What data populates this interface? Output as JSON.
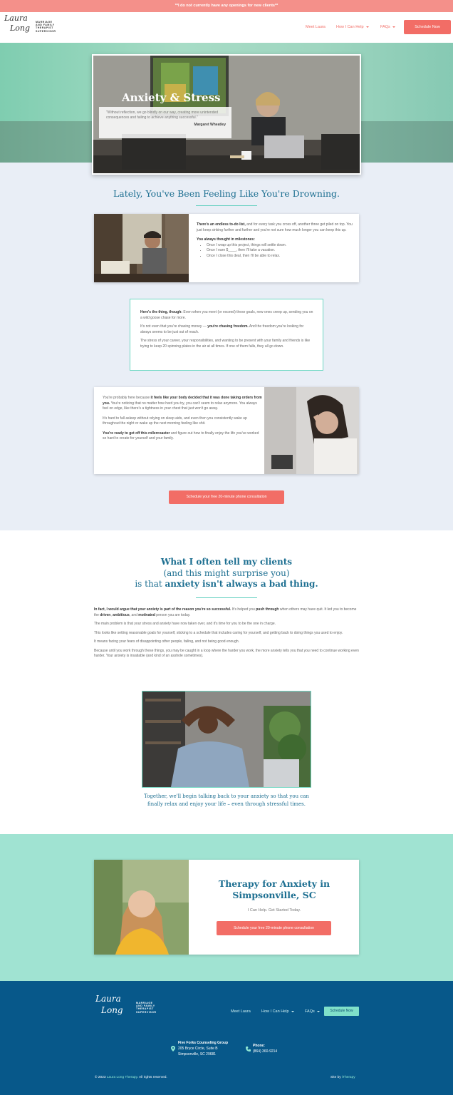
{
  "banner": {
    "text": "**I do not currently have any openings for new clients**"
  },
  "header": {
    "logo_line1": "Laura",
    "logo_line2": "Long",
    "logo_sub1": "MARRIAGE",
    "logo_sub2": "AND FAMILY",
    "logo_sub3": "THERAPIST",
    "logo_sub4": "SUPERVISOR",
    "nav": [
      "Meet Laura",
      "How I Can Help",
      "FAQs"
    ],
    "schedule_label": "Schedule Now"
  },
  "hero": {
    "title": "Anxiety & Stress",
    "quote": "\"Without reflection, we go blindly on our way, creating more unintended consequences and failing to achieve anything successful.\"",
    "quote_author": "Margaret Wheatley"
  },
  "drowning": {
    "heading": "Lately, You've Been Feeling Like You're Drowning.",
    "card1": {
      "p1_bold": "There's an endless to-do list,",
      "p1_rest": " and for every task you cross off, another three get piled on top. You just keep sinking further and further and you're not sure how much longer you can keep this up.",
      "milestones_heading": "You always thought in milestones:",
      "milestones": [
        "Once I wrap up this project, things will settle down.",
        "Once I earn $____, then I'll take a vacation.",
        "Once I close this deal, then I'll be able to relax."
      ]
    },
    "card2": {
      "p1_bold": "Here's the thing, though:",
      "p1_rest": " Even when you meet (or exceed) these goals, new ones creep up, sending you on a wild goose chase for more.",
      "p2_a": "It's not even that you're chasing money — ",
      "p2_bold": "you're chasing freedom.",
      "p2_rest": " And the freedom you're looking for always seems to be just out of reach.",
      "p3": "The stress of your career, your responsibilities, and wanting to be present with your family and friends is like trying to keep 20 spinning plates in the air at all times. If one of them falls, they all go down."
    },
    "card3": {
      "p1_a": "You're probably here because ",
      "p1_bold": "it feels like your body decided that it was done taking orders from you.",
      "p1_rest": " You're noticing that no matter how hard you try, you can't seem to relax anymore. You always feel on edge, like there's a tightness in your chest that just won't go away.",
      "p2": "It's hard to fall asleep without relying on sleep aids, and even then you consistently wake up throughout the night or wake up the next morning feeling like shit.",
      "p3_bold": "You're ready to get off this rollercoaster",
      "p3_rest": " and figure out how to finally enjoy the life you've worked so hard to create for yourself and your family."
    },
    "cta": "Schedule your free 20-minute phone consultation"
  },
  "clients": {
    "line1": "What I often tell my clients",
    "line2": "(and this might surprise you)",
    "line3_a": "is that ",
    "line3_bold": "anxiety isn't always a bad thing.",
    "p1_bold": "In fact, I would argue that your anxiety is part of the reason you're so successful.",
    "p1_a": " It's helped you ",
    "p1_b": "push through",
    "p1_c": " when others may have quit. It led you to become the ",
    "p1_d": "driven",
    "p1_e": ", ",
    "p1_f": "ambitious",
    "p1_g": ", and ",
    "p1_h": "motivated",
    "p1_i": " person you are today.",
    "p2": "The main problem is that your stress and anxiety have now taken over, and it's time for you to be the one in charge.",
    "p3": "This looks like setting reasonable goals for yourself, sticking to a schedule that includes caring for yourself, and getting back to doing things you used to enjoy.",
    "p4": "It means facing your fears of disappointing other people, failing, and not being good enough.",
    "p5": "Because until you work through these things, you may be caught in a loop where the harder you work, the more anxiety tells you that you need to continue working even harder. Your anxiety is insatiable (and kind of an asshole sometimes).",
    "caption": "Together, we'll begin talking back to your anxiety so that you can finally relax and enjoy your life – even through stressful times."
  },
  "therapy": {
    "title": "Therapy for Anxiety in Simpsonville, SC",
    "subtitle": "I Can Help. Get Started Today.",
    "cta": "Schedule your free 20-minute phone consultation"
  },
  "footer": {
    "nav": [
      "Meet Laura",
      "How I Can Help",
      "FAQs"
    ],
    "schedule_label": "Schedule Now",
    "org": "Five Forks Counseling Group",
    "addr1": "205 Bryce Circle, Suite B",
    "addr2": "Simpsonville, SC 29681",
    "phone_label": "Phone:",
    "phone": "(864) 360-9214",
    "copyright_a": "© 2023 ",
    "copyright_link": "Laura Long Therapy",
    "copyright_b": ". All rights reserved.",
    "site_by_a": "Site by ",
    "site_by_link": "iTherapy"
  },
  "colors": {
    "coral": "#f26d66",
    "teal_heading": "#1d6f91",
    "mint": "#a0e3d2",
    "footer_blue": "#07588a"
  }
}
